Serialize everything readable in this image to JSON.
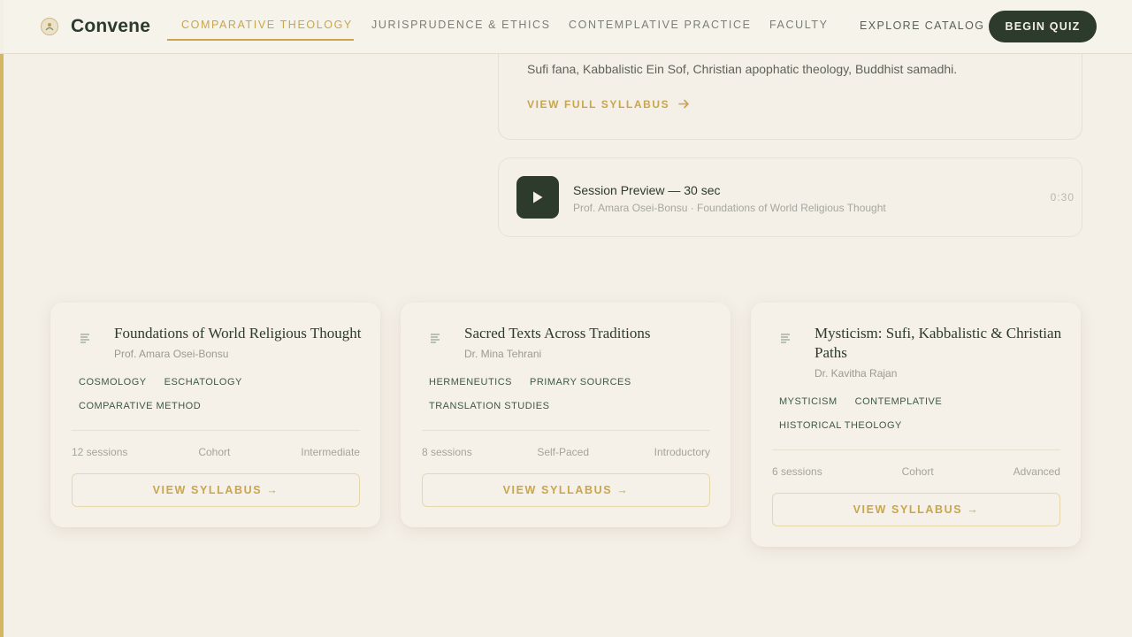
{
  "nav": {
    "brand": "Convene",
    "links": [
      {
        "label": "COMPARATIVE THEOLOGY",
        "active": true
      },
      {
        "label": "JURISPRUDENCE & ETHICS",
        "active": false
      },
      {
        "label": "CONTEMPLATIVE PRACTICE",
        "active": false
      },
      {
        "label": "FACULTY",
        "active": false
      }
    ],
    "explore": "EXPLORE CATALOG",
    "cta": "BEGIN QUIZ"
  },
  "featured": {
    "text": "Sufi fana, Kabbalistic Ein Sof, Christian apophatic theology, Buddhist samadhi.",
    "cta": "VIEW FULL SYLLABUS",
    "cta_icon": "arrow-right-icon"
  },
  "preview": {
    "title": "Session Preview — 30 sec",
    "subtitle": "Prof. Amara Osei-Bonsu · Foundations of World Religious Thought",
    "duration": "0:30",
    "icon": "play-icon"
  },
  "courses": [
    {
      "title": "Foundations of World Religious Thought",
      "instructor": "Prof. Amara Osei-Bonsu",
      "tags": [
        "COSMOLOGY",
        "ESCHATOLOGY",
        "COMPARATIVE METHOD"
      ],
      "sessions": "12 sessions",
      "format": "Cohort",
      "level": "Intermediate",
      "cta": "VIEW SYLLABUS →"
    },
    {
      "title": "Sacred Texts Across Traditions",
      "instructor": "Dr. Mina Tehrani",
      "tags": [
        "HERMENEUTICS",
        "PRIMARY SOURCES",
        "TRANSLATION STUDIES"
      ],
      "sessions": "8 sessions",
      "format": "Self-Paced",
      "level": "Introductory",
      "cta": "VIEW SYLLABUS →"
    },
    {
      "title": "Mysticism: Sufi, Kabbalistic & Christian Paths",
      "instructor": "Dr. Kavitha Rajan",
      "tags": [
        "MYSTICISM",
        "CONTEMPLATIVE",
        "HISTORICAL THEOLOGY"
      ],
      "sessions": "6 sessions",
      "format": "Cohort",
      "level": "Advanced",
      "cta": "VIEW SYLLABUS →"
    }
  ],
  "colors": {
    "background": "#f4efe7",
    "accent_gold": "#c9a64c",
    "dark_green": "#2c3b2c"
  }
}
